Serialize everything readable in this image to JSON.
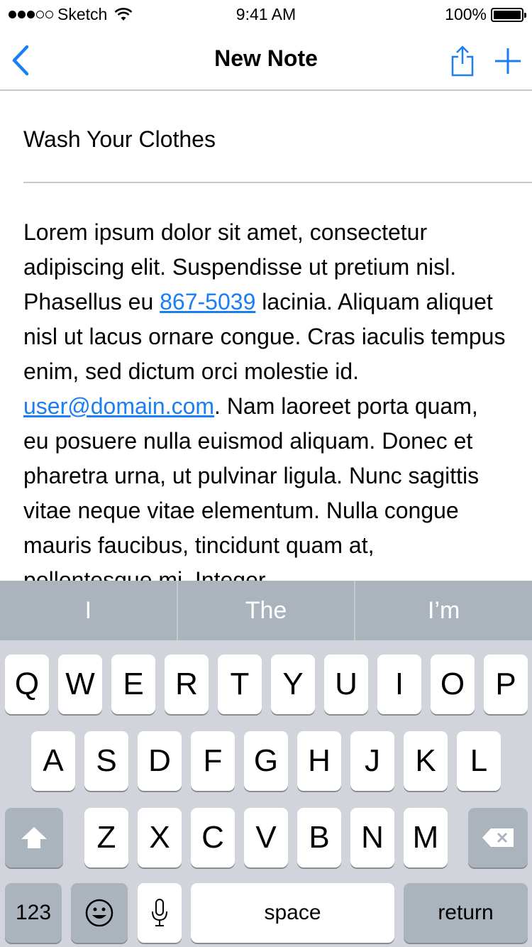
{
  "status_bar": {
    "carrier": "Sketch",
    "time": "9:41 AM",
    "battery": "100%"
  },
  "navbar": {
    "title": "New Note"
  },
  "note": {
    "title": "Wash Your Clothes",
    "body_parts": [
      "Lorem ipsum dolor sit amet, consectetur adipiscing elit. Suspendisse ut pretium nisl. Phasellus eu ",
      "867-5039",
      " lacinia. Aliquam aliquet nisl ut lacus ornare congue. Cras iaculis tempus enim, sed dictum orci molestie id. ",
      "user@domain.com",
      ". Nam laoreet porta quam, eu posuere nulla euismod aliquam. Donec et pharetra urna, ut pulvinar ligula. Nunc sagittis vitae neque vitae elementum. Nulla congue mauris faucibus, tincidunt quam at, pellentesque mi. Integer"
    ]
  },
  "keyboard": {
    "suggestions": [
      "I",
      "The",
      "I’m"
    ],
    "row1": [
      "Q",
      "W",
      "E",
      "R",
      "T",
      "Y",
      "U",
      "I",
      "O",
      "P"
    ],
    "row2": [
      "A",
      "S",
      "D",
      "F",
      "G",
      "H",
      "J",
      "K",
      "L"
    ],
    "row3": [
      "Z",
      "X",
      "C",
      "V",
      "B",
      "N",
      "M"
    ],
    "numbers_label": "123",
    "space_label": "space",
    "return_label": "return",
    "icons": [
      "shift-icon",
      "backspace-icon",
      "emoji-icon",
      "microphone-icon"
    ]
  },
  "colors": {
    "accent": "#1a7ef5",
    "keyboard_bg": "#d1d5db",
    "suggestion_bg": "#abb3bd"
  }
}
